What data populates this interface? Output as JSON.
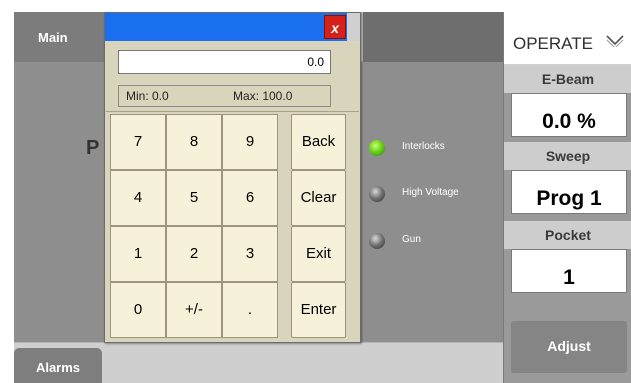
{
  "main": {
    "tab_label": "Main",
    "title_fragment": "P",
    "indicators": [
      {
        "label": "Interlocks",
        "state": "on",
        "color": "#5cc41a"
      },
      {
        "label": "High Voltage",
        "state": "off",
        "color": "#555555"
      },
      {
        "label": "Gun",
        "state": "off",
        "color": "#555555"
      }
    ],
    "alarms_label": "Alarms"
  },
  "right_panel": {
    "mode_label": "OPERATE",
    "mode_icon": "chevron-down-icon",
    "params": [
      {
        "label": "E-Beam",
        "value": "0.0 %"
      },
      {
        "label": "Sweep",
        "value": "Prog 1"
      },
      {
        "label": "Pocket",
        "value": "1"
      }
    ],
    "adjust_label": "Adjust"
  },
  "keypad": {
    "close_label": "x",
    "value": "0.0",
    "min_text": "Min:  0.0",
    "max_text": "Max: 100.0",
    "keys": {
      "k7": "7",
      "k8": "8",
      "k9": "9",
      "k4": "4",
      "k5": "5",
      "k6": "6",
      "k1": "1",
      "k2": "2",
      "k3": "3",
      "k0": "0",
      "sign": "+/-",
      "dot": "."
    },
    "functions": {
      "back": "Back",
      "clear": "Clear",
      "exit": "Exit",
      "enter": "Enter"
    },
    "colors": {
      "titlebar": "#1a6ff0",
      "close": "#d6211a",
      "body": "#d9d4bc",
      "key": "#f6f1d9"
    }
  }
}
